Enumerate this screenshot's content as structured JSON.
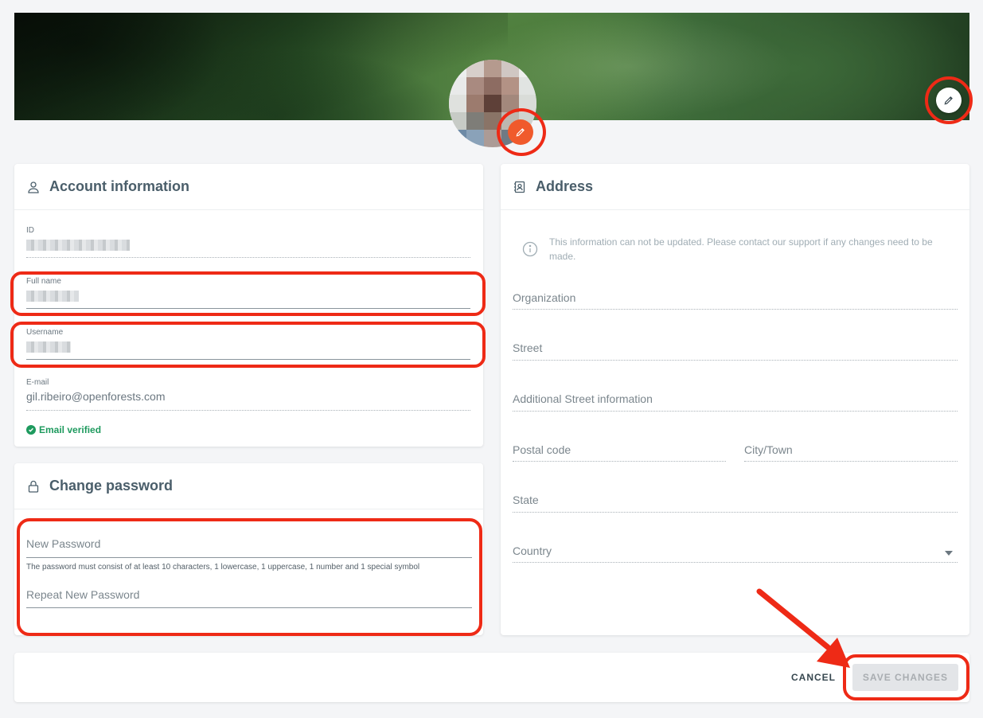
{
  "account": {
    "title": "Account information",
    "id_label": "ID",
    "fullname_label": "Full name",
    "username_label": "Username",
    "email_label": "E-mail",
    "email_value": "gil.ribeiro@openforests.com",
    "email_verified": "Email verified"
  },
  "password": {
    "title": "Change password",
    "new_label": "New Password",
    "hint": "The password must consist of at least 10 characters, 1 lowercase, 1 uppercase, 1 number and 1 special symbol",
    "repeat_label": "Repeat New Password"
  },
  "address": {
    "title": "Address",
    "info": "This information can not be updated. Please contact our support if any changes need to be made.",
    "organization": "Organization",
    "street": "Street",
    "additional": "Additional Street information",
    "postal": "Postal code",
    "city": "City/Town",
    "state": "State",
    "country": "Country"
  },
  "actions": {
    "cancel": "CANCEL",
    "save": "SAVE CHANGES"
  },
  "colors": {
    "highlight": "#ee2a16",
    "accent": "#f05a2c",
    "verified": "#1e9a5e"
  },
  "icons": [
    "pencil-icon",
    "user-icon",
    "lock-icon",
    "address-book-icon",
    "info-icon",
    "check-circle-icon"
  ]
}
